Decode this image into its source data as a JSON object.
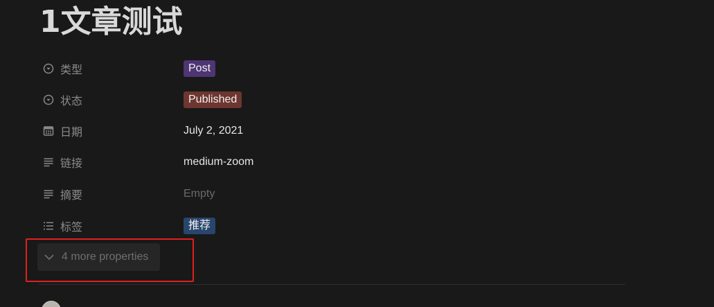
{
  "page": {
    "title": "1文章测试"
  },
  "properties": [
    {
      "icon": "select-icon",
      "name": "类型",
      "value": "Post",
      "kind": "tag",
      "tag_color": "#4e3573"
    },
    {
      "icon": "select-icon",
      "name": "状态",
      "value": "Published",
      "kind": "tag",
      "tag_color": "#6e3630"
    },
    {
      "icon": "calendar-icon",
      "name": "日期",
      "value": "July 2, 2021",
      "kind": "text"
    },
    {
      "icon": "text-icon",
      "name": "链接",
      "value": "medium-zoom",
      "kind": "text"
    },
    {
      "icon": "text-icon",
      "name": "摘要",
      "value": "Empty",
      "kind": "empty"
    },
    {
      "icon": "multi-select-icon",
      "name": "标签",
      "value": "推荐",
      "kind": "tag",
      "tag_color": "#28456c"
    }
  ],
  "more_properties": {
    "label": "4 more properties",
    "icon": "chevron-down-icon"
  },
  "annotation": {
    "color": "#e0201f"
  }
}
